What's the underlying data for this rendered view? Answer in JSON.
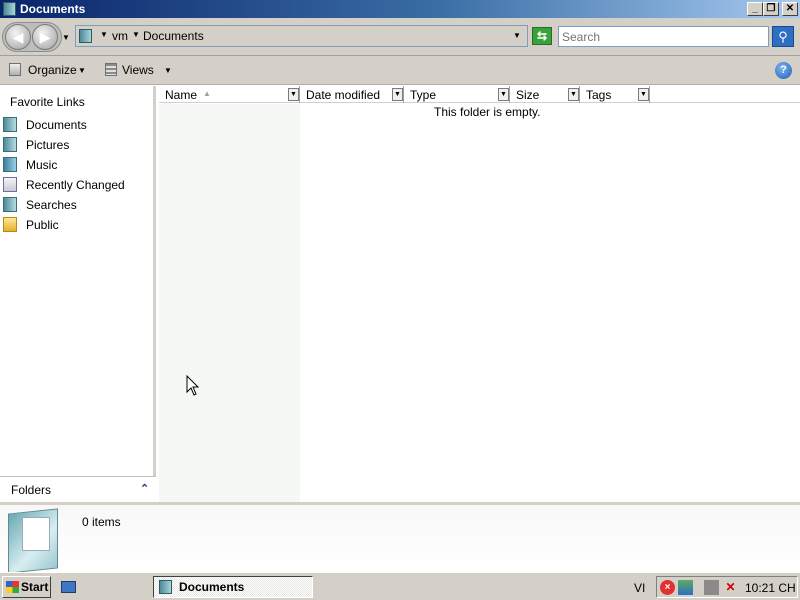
{
  "window": {
    "title": "Documents",
    "buttons": {
      "minimize": "_",
      "maximize": "❐",
      "close": "✕"
    }
  },
  "address": {
    "back_glyph": "◀",
    "forward_glyph": "▶",
    "crumbs": [
      "vm",
      "Documents"
    ],
    "search_placeholder": "Search",
    "refresh_glyph": "⇆"
  },
  "toolbar": {
    "organize_label": "Organize",
    "views_label": "Views",
    "help_label": "?"
  },
  "navpane": {
    "header": "Favorite Links",
    "items": [
      {
        "label": "Documents",
        "icon": "documents-icon"
      },
      {
        "label": "Pictures",
        "icon": "pictures-icon"
      },
      {
        "label": "Music",
        "icon": "music-icon"
      },
      {
        "label": "Recently Changed",
        "icon": "recently-changed-icon"
      },
      {
        "label": "Searches",
        "icon": "searches-icon"
      },
      {
        "label": "Public",
        "icon": "public-folder-icon"
      }
    ],
    "folders_label": "Folders",
    "folders_chevron": "⌃"
  },
  "filelist": {
    "columns": [
      "Name",
      "Date modified",
      "Type",
      "Size",
      "Tags"
    ],
    "sort_column": "Name",
    "empty_message": "This folder is empty."
  },
  "details": {
    "count": "0 items"
  },
  "taskbar": {
    "start_label": "Start",
    "task_label": "Documents",
    "language": "VI",
    "clock": "10:21 CH"
  },
  "colors": {
    "title_gradient_start": "#0a246a",
    "title_gradient_end": "#a6caf0",
    "chrome": "#d4d0c8",
    "link_blue": "#2e6fc4"
  }
}
